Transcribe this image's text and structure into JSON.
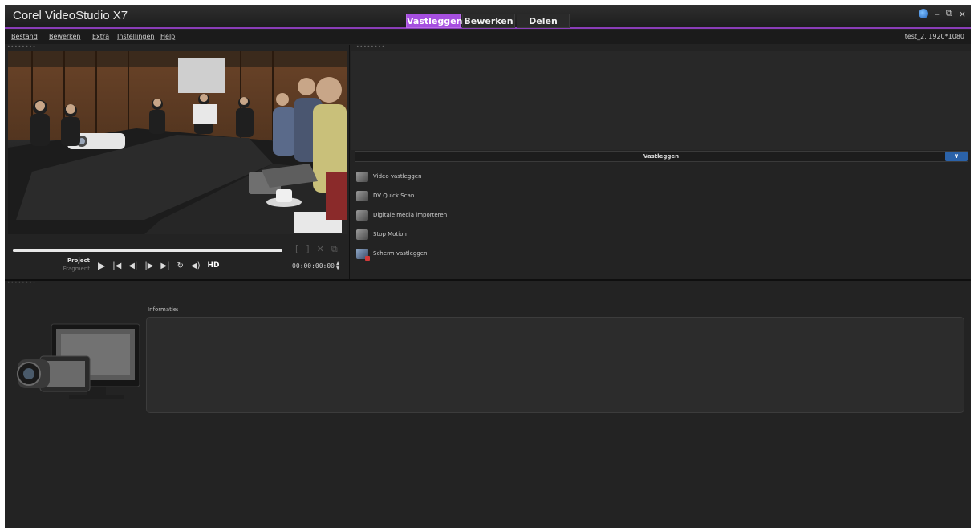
{
  "window": {
    "title": "Corel VideoStudio X7",
    "controls": {
      "minimize": "–",
      "restore": "⧉",
      "close": "×"
    }
  },
  "mode_tabs": [
    {
      "label": "Vastleggen",
      "active": true
    },
    {
      "label": "Bewerken",
      "active": false
    },
    {
      "label": "Delen",
      "active": false
    }
  ],
  "menu": {
    "items": [
      "Bestand",
      "Bewerken",
      "Extra",
      "Instellingen",
      "Help"
    ],
    "project_info": "test_2, 1920*1080"
  },
  "player": {
    "mode_project": "Project",
    "mode_fragment": "Fragment",
    "timecode": "00:00:00:00",
    "hd_label": "HD"
  },
  "capture": {
    "header": "Vastleggen",
    "options": [
      {
        "label": "Video vastleggen",
        "icon": "video-camera-icon"
      },
      {
        "label": "DV Quick Scan",
        "icon": "dv-scan-icon"
      },
      {
        "label": "Digitale media importeren",
        "icon": "import-media-icon"
      },
      {
        "label": "Stop Motion",
        "icon": "stop-motion-icon"
      },
      {
        "label": "Scherm vastleggen",
        "icon": "screen-capture-icon"
      }
    ]
  },
  "info": {
    "label": "Informatie:"
  },
  "colors": {
    "accent": "#a64fe0",
    "panel": "#232323",
    "collapse_button": "#2b62a8"
  }
}
